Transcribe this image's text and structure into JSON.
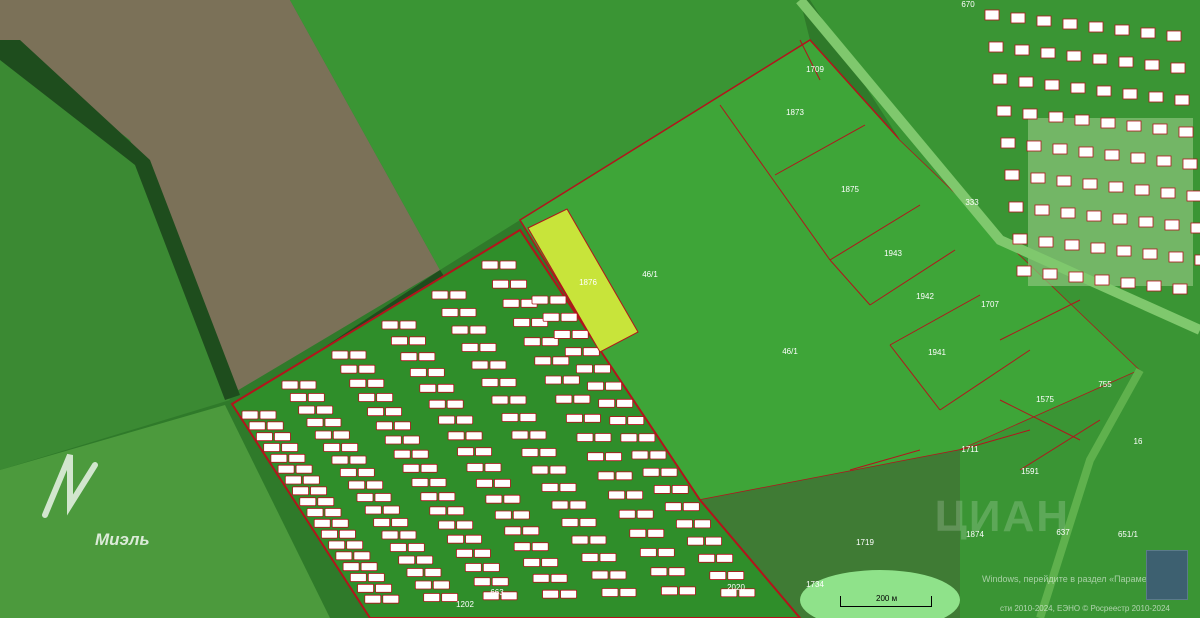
{
  "map": {
    "parcels": [
      {
        "label": "1876",
        "highlight": true
      },
      {
        "label": "46/1"
      },
      {
        "label": "46/1"
      },
      {
        "label": "1873"
      },
      {
        "label": "1875"
      },
      {
        "label": "1943"
      },
      {
        "label": "1942"
      },
      {
        "label": "1941"
      },
      {
        "label": "1709"
      },
      {
        "label": "1707"
      },
      {
        "label": "1575"
      },
      {
        "label": "1711"
      },
      {
        "label": "1591"
      },
      {
        "label": "1719"
      },
      {
        "label": "1874"
      },
      {
        "label": "1734"
      },
      {
        "label": "755"
      },
      {
        "label": "333"
      },
      {
        "label": "670"
      },
      {
        "label": "1202"
      },
      {
        "label": "663"
      },
      {
        "label": "2020"
      },
      {
        "label": "651/1"
      },
      {
        "label": "637"
      },
      {
        "label": "16"
      }
    ],
    "logo_text": "Миэль",
    "watermark": "ЦИАН",
    "activate_text": "Windows, перейдите в раздел «Параметры»",
    "copyright": "сти 2010-2024, ЕЭНО © Росреестр 2010-2024",
    "scale_label": "200 м",
    "colors": {
      "field_green": "#2f8e2a",
      "bright_field": "#3fa43a",
      "parcel_border": "#b3141c",
      "highlight": "#c8e43a"
    }
  }
}
